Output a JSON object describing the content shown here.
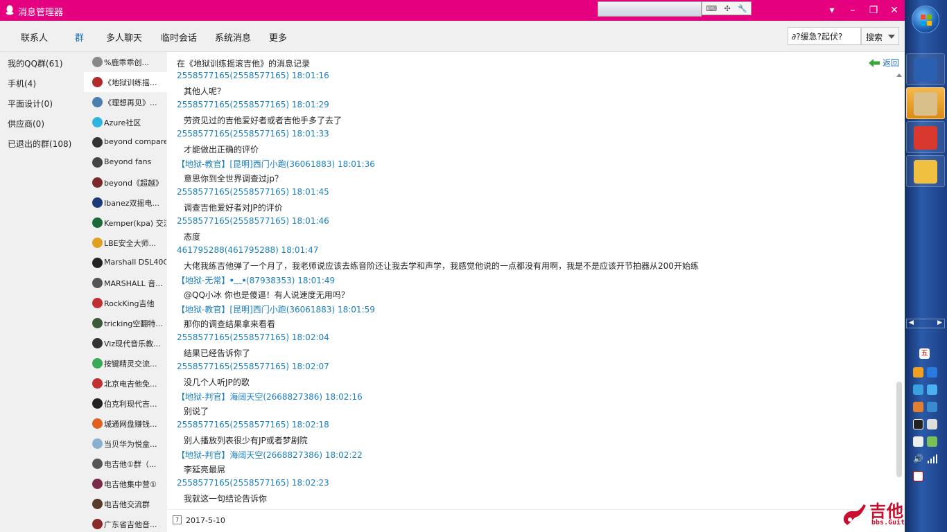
{
  "window": {
    "title": "消息管理器"
  },
  "tabs": [
    {
      "label": "联系人",
      "active": false
    },
    {
      "label": "群",
      "active": true
    },
    {
      "label": "多人聊天",
      "active": false
    },
    {
      "label": "临时会话",
      "active": false
    },
    {
      "label": "系统消息",
      "active": false
    },
    {
      "label": "更多",
      "active": false
    }
  ],
  "search": {
    "value": "∂?缓急?起伏?",
    "button": "搜索"
  },
  "groups": [
    {
      "label": "我的QQ群(61)"
    },
    {
      "label": "手机(4)"
    },
    {
      "label": "平面设计(0)"
    },
    {
      "label": "供应商(0)"
    },
    {
      "label": "已退出的群(108)"
    }
  ],
  "group_list": [
    {
      "name": "%鹿乖乖创...",
      "color": "#888"
    },
    {
      "name": "《地狱训练摇...",
      "color": "#b02a2a",
      "selected": true
    },
    {
      "name": "《理想再见》...",
      "color": "#4a7fb0"
    },
    {
      "name": "Azure社区",
      "color": "#2fb5e0"
    },
    {
      "name": "beyond compare",
      "color": "#333"
    },
    {
      "name": "Beyond fans",
      "color": "#444"
    },
    {
      "name": "beyond《超越》",
      "color": "#7a2a2a"
    },
    {
      "name": "Ibanez双摇电...",
      "color": "#1a3a7a"
    },
    {
      "name": "Kemper(kpa) 交流",
      "color": "#1a6a3a"
    },
    {
      "name": "LBE安全大师...",
      "color": "#e0a020"
    },
    {
      "name": "Marshall DSL40C",
      "color": "#222"
    },
    {
      "name": "MARSHALL 音...",
      "color": "#555"
    },
    {
      "name": "RockKing吉他",
      "color": "#c03030"
    },
    {
      "name": "tricking空翻特...",
      "color": "#3a5a3a"
    },
    {
      "name": "Viz现代音乐教...",
      "color": "#333"
    },
    {
      "name": "按键精灵交流...",
      "color": "#3aaa5a"
    },
    {
      "name": "北京电吉他免...",
      "color": "#c03030"
    },
    {
      "name": "伯克利现代吉...",
      "color": "#222"
    },
    {
      "name": "城通网盘赚钱...",
      "color": "#e06020"
    },
    {
      "name": "当贝华为悦盒...",
      "color": "#8ab0d0"
    },
    {
      "name": "电吉他①群（...",
      "color": "#555"
    },
    {
      "name": "电吉他集中营①",
      "color": "#7a2a4a"
    },
    {
      "name": "电吉他交流群",
      "color": "#5a3a2a"
    },
    {
      "name": "广东省吉他音...",
      "color": "#8a2a2a"
    }
  ],
  "main": {
    "heading": "在《地狱训练摇滚吉他》的消息记录",
    "back_label": "返回",
    "date": "2017-5-10",
    "calendar_day": "7"
  },
  "messages": [
    {
      "sender": "2558577165(2558577165) 18:01:16",
      "text": "其他人呢？"
    },
    {
      "sender": "2558577165(2558577165) 18:01:29",
      "text": "劳资见过的吉他爱好者或者吉他手多了去了"
    },
    {
      "sender": "2558577165(2558577165) 18:01:33",
      "text": "才能做出正确的评价"
    },
    {
      "sender": "【地狱-教官】[昆明]西门小跑(36061883) 18:01:36",
      "text": "意思你到全世界调查过jp？"
    },
    {
      "sender": "2558577165(2558577165) 18:01:45",
      "text": "调查吉他爱好者对JP的评价"
    },
    {
      "sender": "2558577165(2558577165) 18:01:46",
      "text": "态度"
    },
    {
      "sender": "461795288(461795288) 18:01:47",
      "text": "大佬我练吉他弹了一个月了，我老师说应该去练音阶还让我去学和声学，我感觉他说的一点都没有用啊，我是不是应该开节拍器从200开始练"
    },
    {
      "sender": "【地狱-无常】ꔷ﹏ꔷ(87938353) 18:01:49",
      "text": "@QQ小冰 你也是傻逼！有人说速度无用吗？"
    },
    {
      "sender": "【地狱-教官】[昆明]西门小跑(36061883) 18:01:59",
      "text": "那你的调查结果拿来看看"
    },
    {
      "sender": "2558577165(2558577165) 18:02:04",
      "text": "结果已经告诉你了"
    },
    {
      "sender": "2558577165(2558577165) 18:02:07",
      "text": "没几个人听JP的歌"
    },
    {
      "sender": "【地狱-判官】海阔天空(2668827386) 18:02:16",
      "text": "别说了"
    },
    {
      "sender": "2558577165(2558577165) 18:02:18",
      "text": "别人播放列表很少有JP或者梦剧院"
    },
    {
      "sender": "【地狱-判官】海阔天空(2668827386) 18:02:22",
      "text": "李延亮最屌"
    },
    {
      "sender": "2558577165(2558577165) 18:02:23",
      "text": "我就这一句结论告诉你"
    }
  ],
  "watermark": {
    "title": "吉他中国",
    "subtitle": "bbs.GuitarChina.com"
  },
  "taskbar": {
    "apps": [
      {
        "icon": "word-icon",
        "color": "#2b5fb0"
      },
      {
        "icon": "qq-dog-avatar-icon",
        "color": "#d9c08a",
        "active": true
      },
      {
        "icon": "red-cat-icon",
        "color": "#d8382e"
      },
      {
        "icon": "file-explorer-icon",
        "color": "#f0c040"
      }
    ],
    "tray_day": "五"
  }
}
